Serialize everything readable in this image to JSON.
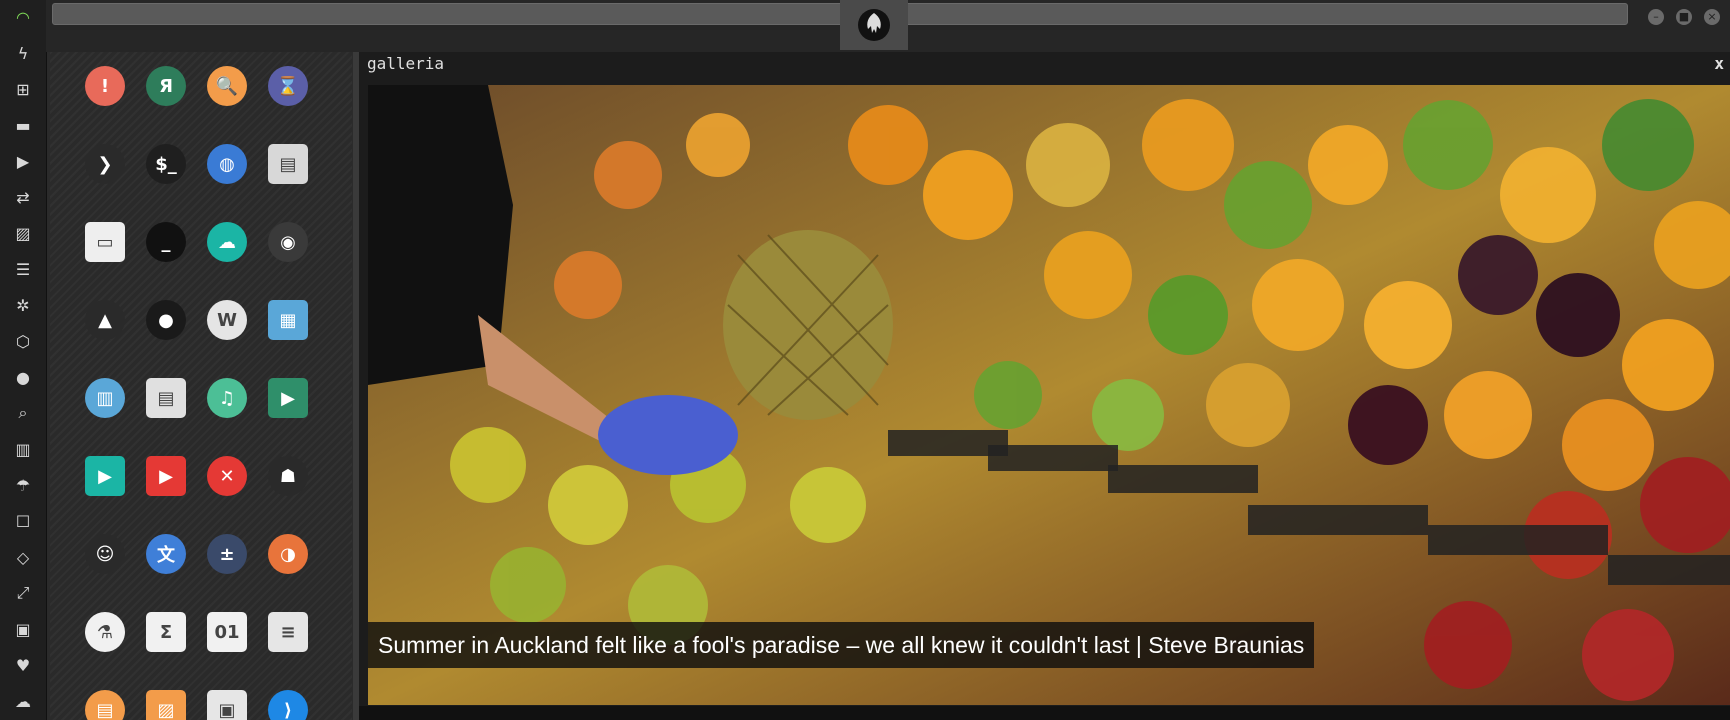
{
  "gallery": {
    "title": "galleria",
    "close_label": "x",
    "caption": "Summer in Auckland felt like a fool's paradise – we all knew it couldn't last | Steve Braunias"
  },
  "dock": {
    "items": [
      "wifi-icon",
      "bolt-icon",
      "windows-icon",
      "archive-icon",
      "play-icon",
      "translate-icon",
      "image-icon",
      "news-icon",
      "settings-wheel-icon",
      "hexagon-icon",
      "globe-icon",
      "search-icon",
      "map-icon",
      "umbrella-icon",
      "contact-icon",
      "code-icon",
      "expand-icon",
      "youtube-icon",
      "heart-icon",
      "cloud-icon"
    ]
  },
  "window_controls": {
    "minimize": "–",
    "maximize": "■",
    "close": "×"
  },
  "apps": [
    {
      "name": "warning-app",
      "bg": "#e86a5a",
      "glyph": "!"
    },
    {
      "name": "yandex-app",
      "bg": "#2e7d5b",
      "glyph": "Я"
    },
    {
      "name": "search-app",
      "bg": "#f39c4a",
      "glyph": "🔍"
    },
    {
      "name": "hourglass-app",
      "bg": "#5b5fa8",
      "glyph": "⌛"
    },
    {
      "name": "terminal-arrow-app",
      "bg": "#2a2a2a",
      "glyph": "❯"
    },
    {
      "name": "shell-app",
      "bg": "#1f1f1f",
      "glyph": "$_"
    },
    {
      "name": "web-browser-app",
      "bg": "#3a7bd5",
      "glyph": "◍"
    },
    {
      "name": "file-manager-app",
      "bg": "#d8d8d8",
      "glyph": "▤"
    },
    {
      "name": "window-app",
      "bg": "#eeeeee",
      "glyph": "▭"
    },
    {
      "name": "underscore-app",
      "bg": "#111111",
      "glyph": "_"
    },
    {
      "name": "cloud-lock-app",
      "bg": "#1bb5a5",
      "glyph": "☁"
    },
    {
      "name": "github-app",
      "bg": "#3a3a3a",
      "glyph": "◉"
    },
    {
      "name": "starfleet-app",
      "bg": "#2a2a2a",
      "glyph": "▲"
    },
    {
      "name": "death-star-app",
      "bg": "#1a1a1a",
      "glyph": "●"
    },
    {
      "name": "wikipedia-app",
      "bg": "#e5e5e5",
      "glyph": "W"
    },
    {
      "name": "world-map-app",
      "bg": "#5aa7d8",
      "glyph": "▦"
    },
    {
      "name": "books-app",
      "bg": "#5aa7d8",
      "glyph": "▥"
    },
    {
      "name": "notes-app",
      "bg": "#e0e0e0",
      "glyph": "▤"
    },
    {
      "name": "music-app",
      "bg": "#4cbf96",
      "glyph": "♫"
    },
    {
      "name": "video-app",
      "bg": "#2f8f6a",
      "glyph": "▶"
    },
    {
      "name": "player-app",
      "bg": "#1bb5a5",
      "glyph": "▶"
    },
    {
      "name": "youtube-app",
      "bg": "#e53935",
      "glyph": "▶"
    },
    {
      "name": "close-app",
      "bg": "#e53935",
      "glyph": "✕"
    },
    {
      "name": "ironman-app",
      "bg": "#2a2a2a",
      "glyph": "☗"
    },
    {
      "name": "robot-app",
      "bg": "#2a2a2a",
      "glyph": "☺"
    },
    {
      "name": "translate-app",
      "bg": "#3f7fd8",
      "glyph": "文"
    },
    {
      "name": "calculator-app",
      "bg": "#3a4a6a",
      "glyph": "±"
    },
    {
      "name": "photos-app",
      "bg": "#e8743b",
      "glyph": "◑"
    },
    {
      "name": "lab-app",
      "bg": "#f1f1f1",
      "glyph": "⚗"
    },
    {
      "name": "sigma-app",
      "bg": "#f1f1f1",
      "glyph": "Σ"
    },
    {
      "name": "binary-app",
      "bg": "#f1f1f1",
      "glyph": "01"
    },
    {
      "name": "text-editor-app",
      "bg": "#e6e6e6",
      "glyph": "≡"
    },
    {
      "name": "document-app",
      "bg": "#f39c4a",
      "glyph": "▤"
    },
    {
      "name": "image-viewer-app",
      "bg": "#f39c4a",
      "glyph": "▨"
    },
    {
      "name": "presentation-app",
      "bg": "#e6e6e6",
      "glyph": "▣"
    },
    {
      "name": "vscode-app",
      "bg": "#1e88e5",
      "glyph": "⟩"
    }
  ],
  "colors": {
    "dock_bg": "#1f1f1f",
    "panel_bg": "#2a2a2a",
    "caption_bg": "#0f0f0f"
  }
}
